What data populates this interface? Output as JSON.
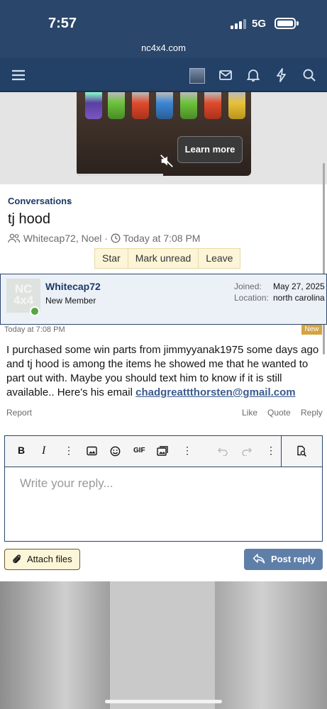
{
  "status_bar": {
    "time": "7:57",
    "network": "5G"
  },
  "browser": {
    "url": "nc4x4.com"
  },
  "nav": {
    "icons": [
      "menu-icon",
      "avatar",
      "mail-icon",
      "bell-icon",
      "bolt-icon",
      "search-icon"
    ]
  },
  "ad": {
    "cta": "Learn more"
  },
  "conversation": {
    "breadcrumb": "Conversations",
    "title": "tj hood",
    "participants": "Whitecap72, Noel",
    "separator": "·",
    "time": "Today at 7:08 PM",
    "buttons": [
      "Star",
      "Mark unread",
      "Leave"
    ]
  },
  "message": {
    "avatar_text_1": "NC",
    "avatar_text_2": "4x4",
    "author": "Whitecap72",
    "role": "New Member",
    "joined_label": "Joined:",
    "joined_value": "May 27, 2025",
    "location_label": "Location:",
    "location_value": "north carolina",
    "time": "Today at 7:08 PM",
    "badge": "New",
    "text": "I purchased some win parts from jimmyyanak1975 some days ago and tj hood is among the items he showed me that he wanted to part out with. Maybe you should text him to know if it is still available.. Here's his email",
    "email": "chadgreattthorsten@gmail.com",
    "actions": {
      "report": "Report",
      "like": "Like",
      "quote": "Quote",
      "reply": "Reply"
    }
  },
  "editor": {
    "bold": "B",
    "italic": "I",
    "more": "⋮",
    "gif": "GIF",
    "placeholder": "Write your reply..."
  },
  "buttons": {
    "attach": "Attach files",
    "post": "Post reply"
  },
  "colors": {
    "header": "#2b466b",
    "nav": "#234066",
    "link": "#1c3a66",
    "button_fill": "#fdf5d8",
    "post_button": "#5f7fa8",
    "new_badge": "#d4a340",
    "online": "#59a542"
  }
}
